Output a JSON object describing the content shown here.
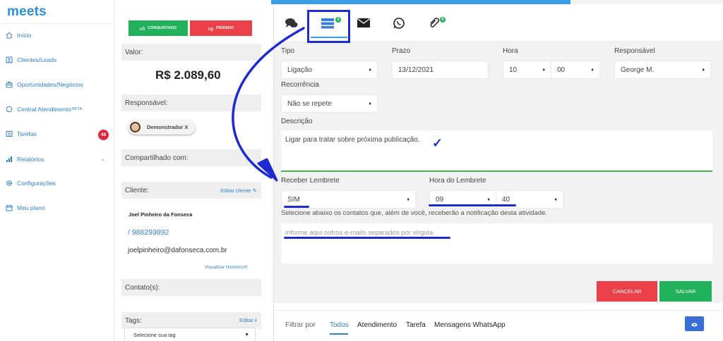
{
  "app": {
    "logo": "meets"
  },
  "sidebar": {
    "items": [
      {
        "label": "Início",
        "icon": "home-icon"
      },
      {
        "label": "Clientes/Leads",
        "icon": "contact-card-icon"
      },
      {
        "label": "Oportunidades/Negócios",
        "icon": "briefcase-icon"
      },
      {
        "label": "Central Atendimento",
        "sup": "BETA",
        "icon": "chat-icon"
      },
      {
        "label": "Tarefas",
        "icon": "tasks-icon",
        "badge": "48"
      },
      {
        "label": "Relatórios",
        "icon": "bar-chart-icon"
      },
      {
        "label": "Configurações",
        "icon": "gear-icon"
      },
      {
        "label": "Meu plano",
        "icon": "calendar-icon"
      }
    ]
  },
  "deal": {
    "won_label": "CONQUISTADO",
    "lost_label": "PERDIDO",
    "valor_label": "Valor:",
    "valor": "R$ 2.089,60",
    "responsavel_label": "Responsável:",
    "responsavel": "Demonstrador X",
    "compartilhado_label": "Compartilhado com:",
    "cliente_label": "Cliente:",
    "editar_cliente": "Editar cliente",
    "cliente_nome": "Joel Pinheiro da Fonseca",
    "cliente_telefone": "/ 988293892",
    "cliente_email": "joelpinheiro@dafonseca.com.br",
    "visualizar_historico": "Visualizar Histórico",
    "contatos_label": "Contato(s):",
    "tags_label": "Tags:",
    "tags_editar": "Editar",
    "tags_placeholder": "Selecione sua tag"
  },
  "tabs": {
    "tasks_badge": "2",
    "attachments_badge": "0"
  },
  "form": {
    "tipo_label": "Tipo",
    "tipo": "Ligação",
    "prazo_label": "Prazo",
    "prazo": "13/12/2021",
    "hora_label": "Hora",
    "hora_h": "10",
    "hora_m": "00",
    "responsavel_label": "Responsável",
    "responsavel": "George M.",
    "recorrencia_label": "Recorrência",
    "recorrencia": "Não se repete",
    "descricao_label": "Descrição",
    "descricao": "Ligar para tratar sobre próxima publicação.",
    "lembrete_label": "Receber Lembrete",
    "lembrete": "SIM",
    "hora_lembrete_label": "Hora do Lembrete",
    "hora_lembrete_h": "09",
    "hora_lembrete_m": "40",
    "nota": "Selecione abaixo os contatos que, além de você, receberão a notificação desta atividade.",
    "emails_placeholder": "informe aqui outros e-mails separados por vírgula",
    "cancelar": "CANCELAR",
    "salvar": "SALVAR"
  },
  "filters": {
    "label": "Filtrar por",
    "items": [
      "Todos",
      "Atendimento",
      "Tarefa",
      "Mensagens WhatsApp"
    ]
  },
  "colors": {
    "accent": "#2f80c8",
    "success": "#21b15a",
    "danger": "#ec4049",
    "annotation": "#1d2bd0"
  }
}
